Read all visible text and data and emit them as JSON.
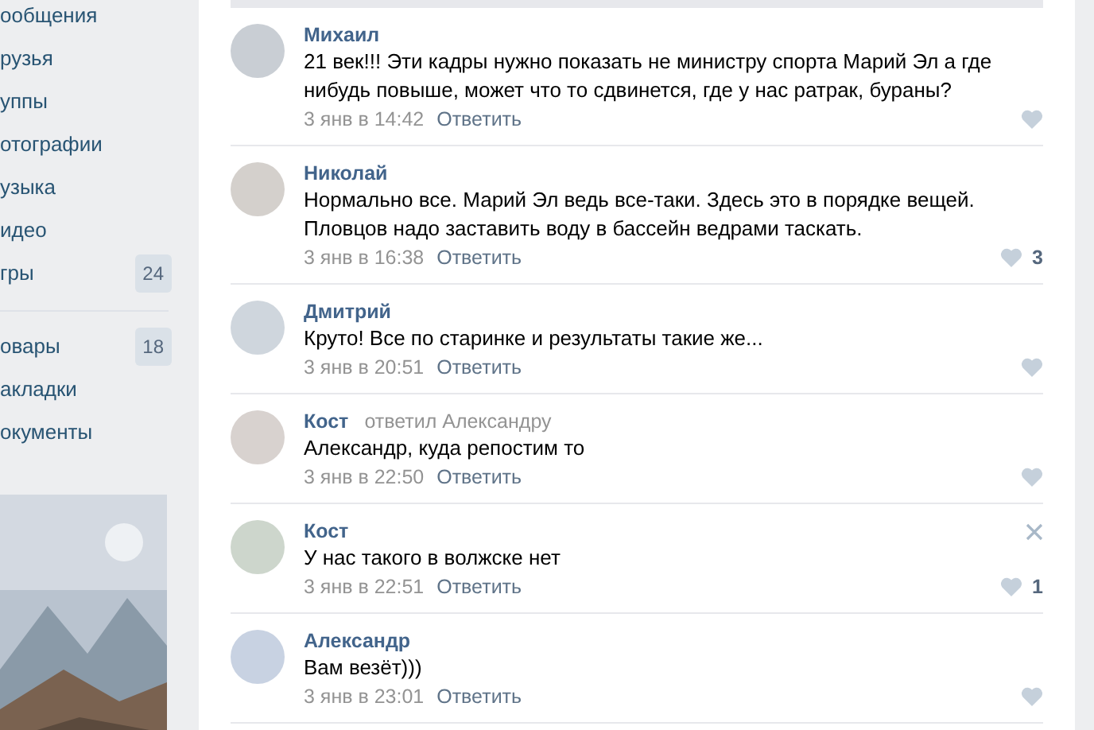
{
  "sidebar": {
    "items": [
      {
        "label": "ообщения"
      },
      {
        "label": "рузья"
      },
      {
        "label": "уппы"
      },
      {
        "label": "отографии"
      },
      {
        "label": "узыка"
      },
      {
        "label": "идео"
      },
      {
        "label": "гры",
        "count": "24"
      },
      {
        "label": "овары",
        "count": "18",
        "divider_before": true
      },
      {
        "label": "акладки"
      },
      {
        "label": "окументы"
      }
    ]
  },
  "comments": [
    {
      "author": "Михаил",
      "text": "21 век!!! Эти кадры нужно показать не министру спорта Марий Эл а где нибудь повыше, может что то сдвинется, где у нас ратрак, бураны?",
      "date": "3 янв в 14:42",
      "reply": "Ответить",
      "close_visible": false
    },
    {
      "author": "Николай",
      "text": "Нормально все. Марий Эл ведь все-таки. Здесь это в порядке вещей. Пловцов надо заставить воду в бассейн ведрами таскать.",
      "date": "3 янв в 16:38",
      "reply": "Ответить",
      "likes": "3",
      "close_visible": false
    },
    {
      "author": "Дмитрий",
      "text": "Круто! Все по старинке и результаты такие же...",
      "date": "3 янв в 20:51",
      "reply": "Ответить",
      "close_visible": false
    },
    {
      "author": "Кост",
      "replied_to": "ответил Александру",
      "text": "Александр, куда репостим то",
      "date": "3 янв в 22:50",
      "reply": "Ответить",
      "close_visible": false
    },
    {
      "author": "Кост",
      "text": "У нас такого в волжске нет",
      "date": "3 янв в 22:51",
      "reply": "Ответить",
      "likes": "1",
      "close_visible": true
    },
    {
      "author": "Александр",
      "text": "Вам везёт)))",
      "date": "3 янв в 23:01",
      "reply": "Ответить",
      "close_visible": false
    }
  ]
}
